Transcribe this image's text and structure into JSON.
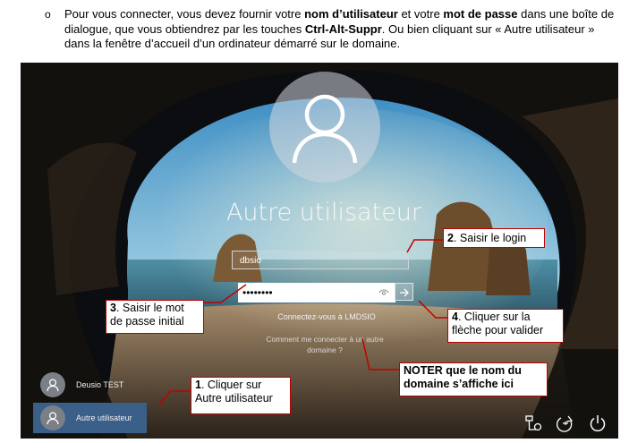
{
  "doc": {
    "bullet": "o",
    "t1": "Pour vous connecter, vous devez fournir votre ",
    "b1": "nom d’utilisateur",
    "t2": " et votre ",
    "b2": "mot de passe",
    "t3": " dans une boîte de dialogue, que vous obtiendrez par les touches ",
    "b3": "Ctrl-Alt-Suppr",
    "t4": ". Ou bien cliquant sur « Autre utilisateur » dans la fenêtre d’accueil d’un ordinateur démarré sur le domaine."
  },
  "login": {
    "title": "Autre utilisateur",
    "username_value": "dbsio",
    "password_mask": "••••••••",
    "connect_to": "Connectez-vous à LMDSIO",
    "howto_link": "Comment me connecter à un autre domaine ?"
  },
  "users": [
    {
      "name": "Deusio TEST"
    },
    {
      "name": "Autre utilisateur"
    }
  ],
  "callouts": {
    "c1_num": "1",
    "c1_text": ". Cliquer sur Autre utilisateur",
    "c2_num": "2",
    "c2_text": ". Saisir le login",
    "c3_num": "3",
    "c3_text": ". Saisir le mot de passe initial",
    "c4_num": "4",
    "c4_text": ". Cliquer sur la flèche pour valider",
    "c5_text": "NOTER que le nom du domaine s’affiche ici"
  },
  "icons": {
    "user": "user-silhouette-icon",
    "eye": "eye-icon",
    "arrow": "arrow-right-icon",
    "network": "network-icon",
    "accessibility": "ease-of-access-icon",
    "power": "power-icon"
  },
  "colors": {
    "accent": "#3a5f88",
    "callout_border": "#c00000"
  }
}
